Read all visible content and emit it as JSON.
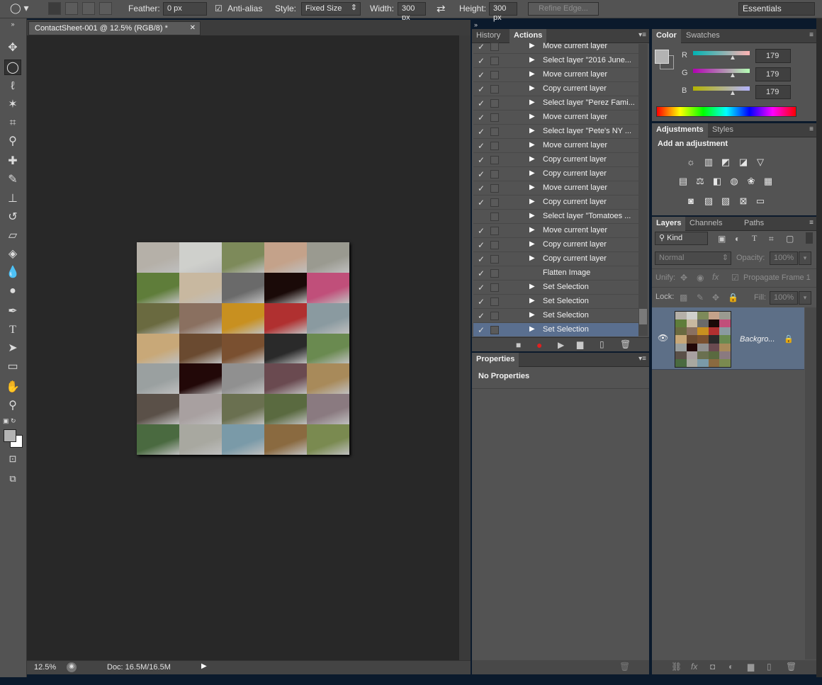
{
  "options_bar": {
    "feather_label": "Feather:",
    "feather_value": "0 px",
    "antialias_label": "Anti-alias",
    "style_label": "Style:",
    "style_value": "Fixed Size",
    "width_label": "Width:",
    "width_value": "300 px",
    "height_label": "Height:",
    "height_value": "300 px",
    "refine_edge": "Refine Edge...",
    "workspace": "Essentials"
  },
  "document": {
    "tab_title": "ContactSheet-001 @ 12.5% (RGB/8) *",
    "zoom": "12.5%",
    "doc_size": "Doc: 16.5M/16.5M"
  },
  "actions_panel": {
    "tabs": [
      "History",
      "Actions"
    ],
    "rows": [
      {
        "checked": true,
        "expand": true,
        "label": "Move current layer"
      },
      {
        "checked": true,
        "expand": true,
        "label": "Select layer \"2016 June..."
      },
      {
        "checked": true,
        "expand": true,
        "label": "Move current layer"
      },
      {
        "checked": true,
        "expand": true,
        "label": "Copy current layer"
      },
      {
        "checked": true,
        "expand": true,
        "label": "Select layer \"Perez Fami..."
      },
      {
        "checked": true,
        "expand": true,
        "label": "Move current layer"
      },
      {
        "checked": true,
        "expand": true,
        "label": "Select layer \"Pete's NY ..."
      },
      {
        "checked": true,
        "expand": true,
        "label": "Move current layer"
      },
      {
        "checked": true,
        "expand": true,
        "label": "Copy current layer"
      },
      {
        "checked": true,
        "expand": true,
        "label": "Copy current layer"
      },
      {
        "checked": true,
        "expand": true,
        "label": "Move current layer"
      },
      {
        "checked": true,
        "expand": true,
        "label": "Copy current layer"
      },
      {
        "checked": false,
        "expand": true,
        "label": "Select layer \"Tomatoes ..."
      },
      {
        "checked": true,
        "expand": true,
        "label": "Move current layer"
      },
      {
        "checked": true,
        "expand": true,
        "label": "Copy current layer"
      },
      {
        "checked": true,
        "expand": true,
        "label": "Copy current layer"
      },
      {
        "checked": true,
        "expand": false,
        "label": "Flatten Image"
      },
      {
        "checked": true,
        "expand": true,
        "label": "Set Selection"
      },
      {
        "checked": true,
        "expand": true,
        "label": "Set Selection"
      },
      {
        "checked": true,
        "expand": true,
        "label": "Set Selection"
      },
      {
        "checked": true,
        "expand": true,
        "label": "Set Selection"
      }
    ]
  },
  "properties_panel": {
    "tab": "Properties",
    "message": "No Properties"
  },
  "color_panel": {
    "tabs": [
      "Color",
      "Swatches"
    ],
    "r_label": "R",
    "r_value": "179",
    "g_label": "G",
    "g_value": "179",
    "b_label": "B",
    "b_value": "179",
    "fg_color": "#b3b3b3"
  },
  "adjustments_panel": {
    "tabs": [
      "Adjustments",
      "Styles"
    ],
    "title": "Add an adjustment"
  },
  "layers_panel": {
    "tabs": [
      "Layers",
      "Channels",
      "Paths"
    ],
    "filter_kind": "Kind",
    "blend_mode": "Normal",
    "opacity_label": "Opacity:",
    "opacity_value": "100%",
    "unify_label": "Unify:",
    "propagate_label": "Propagate Frame 1",
    "lock_label": "Lock:",
    "fill_label": "Fill:",
    "fill_value": "100%",
    "layer_name": "Backgro..."
  },
  "thumb_colors": [
    "#b5b0a8",
    "#cfd0cc",
    "#7d8a5a",
    "#c4a28a",
    "#9a9a90",
    "#5f7d3a",
    "#c8b8a0",
    "#6a6a6a",
    "#1a0a08",
    "#c04f7a",
    "#6a6a40",
    "#8a7060",
    "#c89020",
    "#b03030",
    "#8a9aa0",
    "#c8a878",
    "#6a4a30",
    "#7a5030",
    "#2a2a2a",
    "#6a8a50",
    "#9aa0a0",
    "#220808",
    "#909090",
    "#6a4a50",
    "#a88a5a",
    "#5a5048",
    "#a8a0a0",
    "#6a7050",
    "#5a6a40",
    "#8a7a80",
    "#4a6a40",
    "#a8a8a0",
    "#7a9aa8",
    "#8a6a40",
    "#7a8a50"
  ]
}
